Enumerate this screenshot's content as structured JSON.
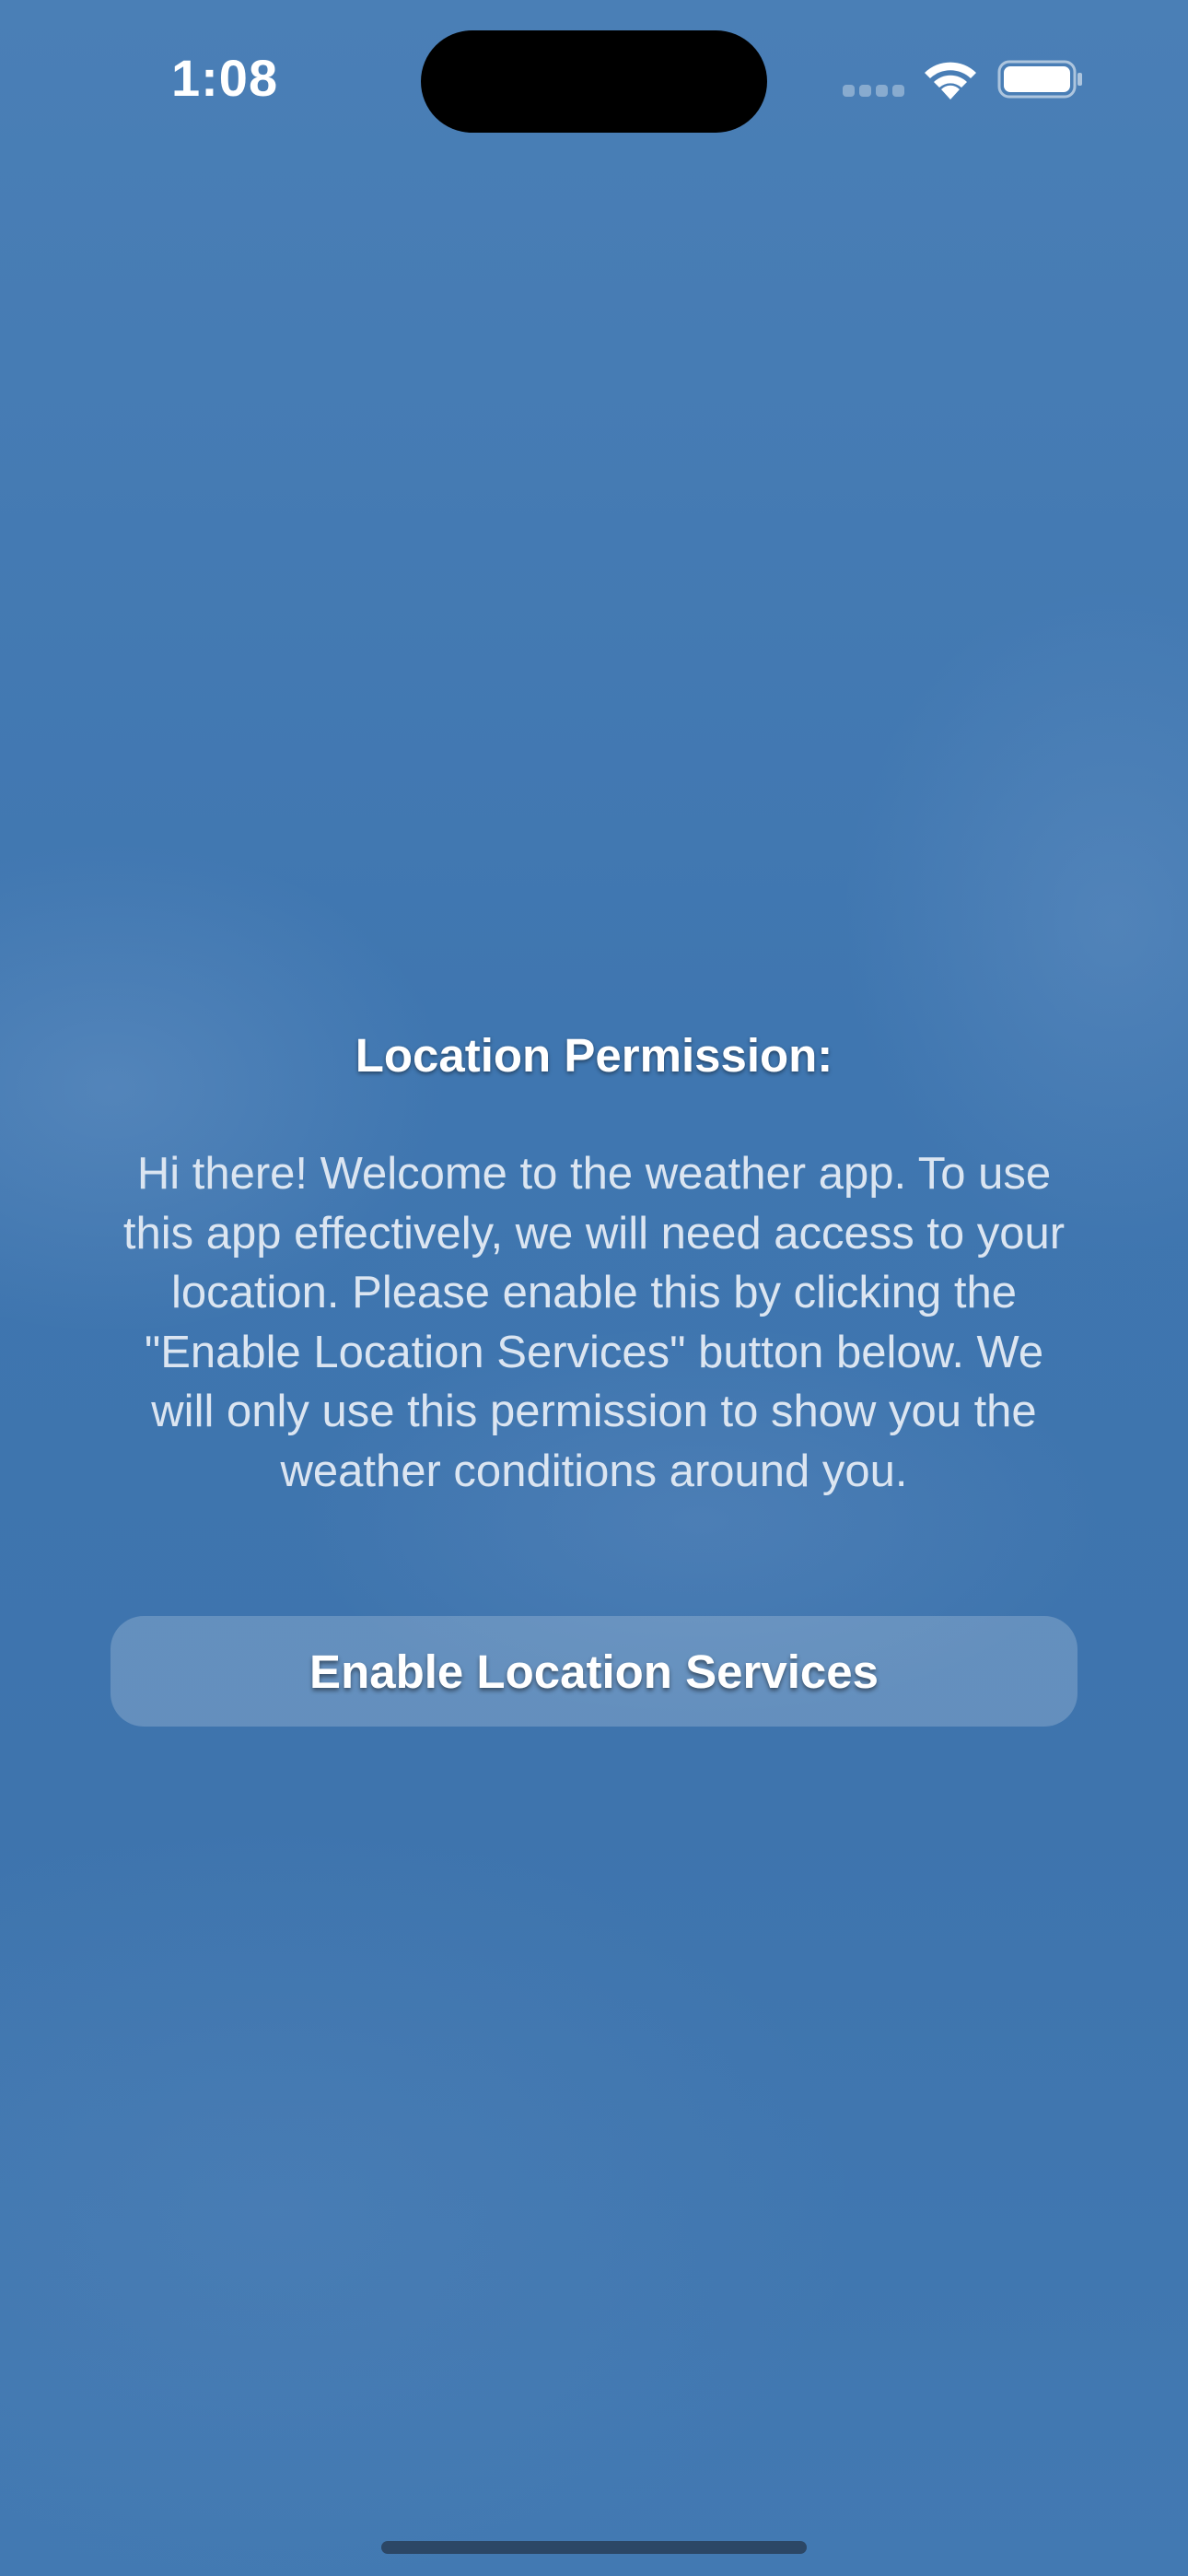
{
  "status_bar": {
    "time": "1:08",
    "signal_icon": "cellular-signal-icon",
    "wifi_icon": "wifi-icon",
    "battery_icon": "battery-icon"
  },
  "permission": {
    "title": "Location Permission:",
    "message": "Hi there! Welcome to the weather app. To use this app effectively, we will need access to your location. Please enable this by clicking the \"Enable Location Services\" button below. We will only use this permission to show you the weather conditions around you.",
    "button_label": "Enable Location Services"
  },
  "colors": {
    "background": "#4279b2",
    "text": "#ffffff",
    "button_fill": "rgba(255,255,255,0.20)"
  }
}
